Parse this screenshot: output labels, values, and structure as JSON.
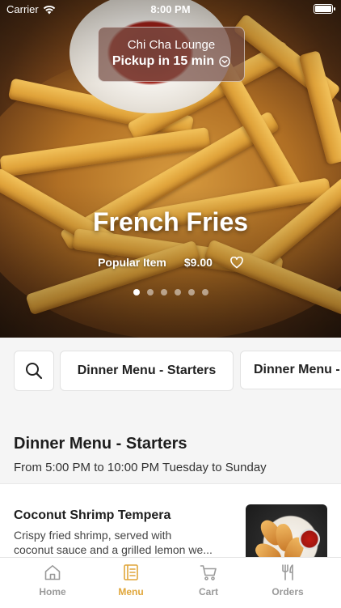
{
  "status_bar": {
    "carrier": "Carrier",
    "time": "8:00 PM",
    "icons": [
      "wifi-icon",
      "battery-icon"
    ]
  },
  "pickup": {
    "location": "Chi Cha Lounge",
    "time_text": "Pickup in 15 min",
    "icon": "chevron-down-circle-icon"
  },
  "hero": {
    "title": "French Fries",
    "tag": "Popular Item",
    "price": "$9.00",
    "favorite_icon": "heart-icon",
    "carousel": {
      "total": 6,
      "active": 1
    }
  },
  "categories": {
    "search_icon": "search-icon",
    "items": [
      {
        "label": "Dinner Menu - Starters"
      },
      {
        "label": "Dinner Menu - "
      }
    ]
  },
  "section": {
    "title": "Dinner Menu - Starters",
    "hours": "From 5:00 PM to 10:00 PM Tuesday to Sunday"
  },
  "menu_items": [
    {
      "name": "Coconut Shrimp Tempera",
      "description": "Crispy fried shrimp, served with\ncoconut sauce and a grilled lemon we..."
    }
  ],
  "bottom_nav": {
    "active": "Menu",
    "items": [
      {
        "label": "Home",
        "icon": "home-icon"
      },
      {
        "label": "Menu",
        "icon": "menu-book-icon"
      },
      {
        "label": "Cart",
        "icon": "cart-icon"
      },
      {
        "label": "Orders",
        "icon": "utensils-icon"
      }
    ]
  },
  "colors": {
    "accent": "#e0a63a",
    "inactive": "#9a9a9a",
    "background": "#f5f5f5"
  }
}
